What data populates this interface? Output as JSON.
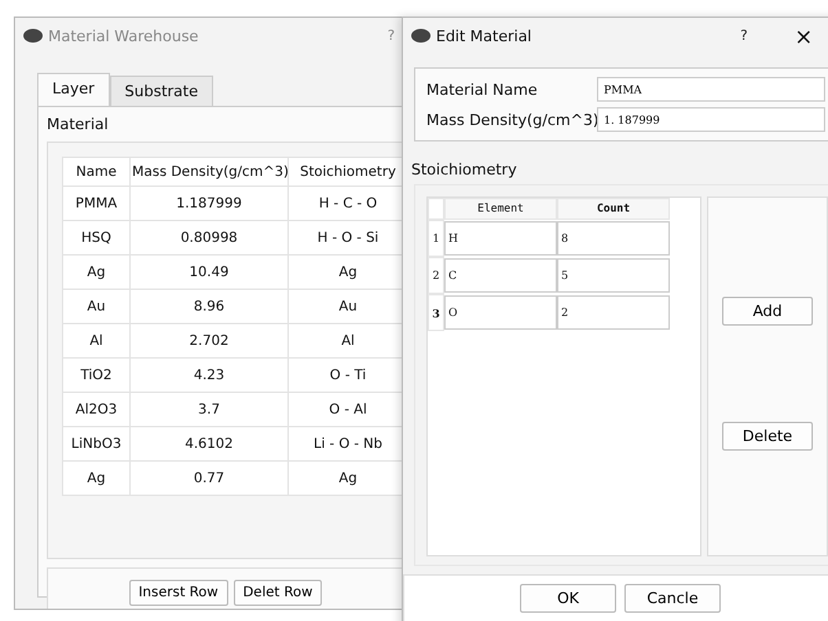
{
  "back_window": {
    "title": "Material Warehouse",
    "help": "?",
    "tabs": [
      {
        "label": "Layer",
        "selected": true
      },
      {
        "label": "Substrate",
        "selected": false
      }
    ],
    "group_label": "Material",
    "table": {
      "columns": [
        "Name",
        "Mass Density(g/cm^3)",
        "Stoichiometry"
      ],
      "rows": [
        [
          "PMMA",
          "1.187999",
          "H - C - O"
        ],
        [
          "HSQ",
          "0.80998",
          "H - O - Si"
        ],
        [
          "Ag",
          "10.49",
          "Ag"
        ],
        [
          "Au",
          "8.96",
          "Au"
        ],
        [
          "Al",
          "2.702",
          "Al"
        ],
        [
          "TiO2",
          "4.23",
          "O - Ti"
        ],
        [
          "Al2O3",
          "3.7",
          "O - Al"
        ],
        [
          "LiNbO3",
          "4.6102",
          "Li - O - Nb"
        ],
        [
          "Ag",
          "0.77",
          "Ag"
        ]
      ]
    },
    "buttons": [
      "Inserst Row",
      "Delet Row"
    ]
  },
  "front_window": {
    "title": "Edit Material",
    "help": "?",
    "close": "×",
    "fields": [
      {
        "label": "Material Name",
        "value": "PMMA"
      },
      {
        "label": "Mass Density(g/cm^3)",
        "value": "1. 187999"
      }
    ],
    "group_label": "Stoichiometry",
    "table": {
      "columns": [
        "Element",
        "Count"
      ],
      "rows": [
        {
          "number": "1",
          "cells": [
            "H",
            "8"
          ],
          "current": false
        },
        {
          "number": "2",
          "cells": [
            "C",
            "5"
          ],
          "current": false
        },
        {
          "number": "3",
          "cells": [
            "O",
            "2"
          ],
          "current": true
        }
      ]
    },
    "side_buttons": [
      "Add",
      "Delete"
    ],
    "buttons": [
      "OK",
      "Cancle"
    ]
  }
}
